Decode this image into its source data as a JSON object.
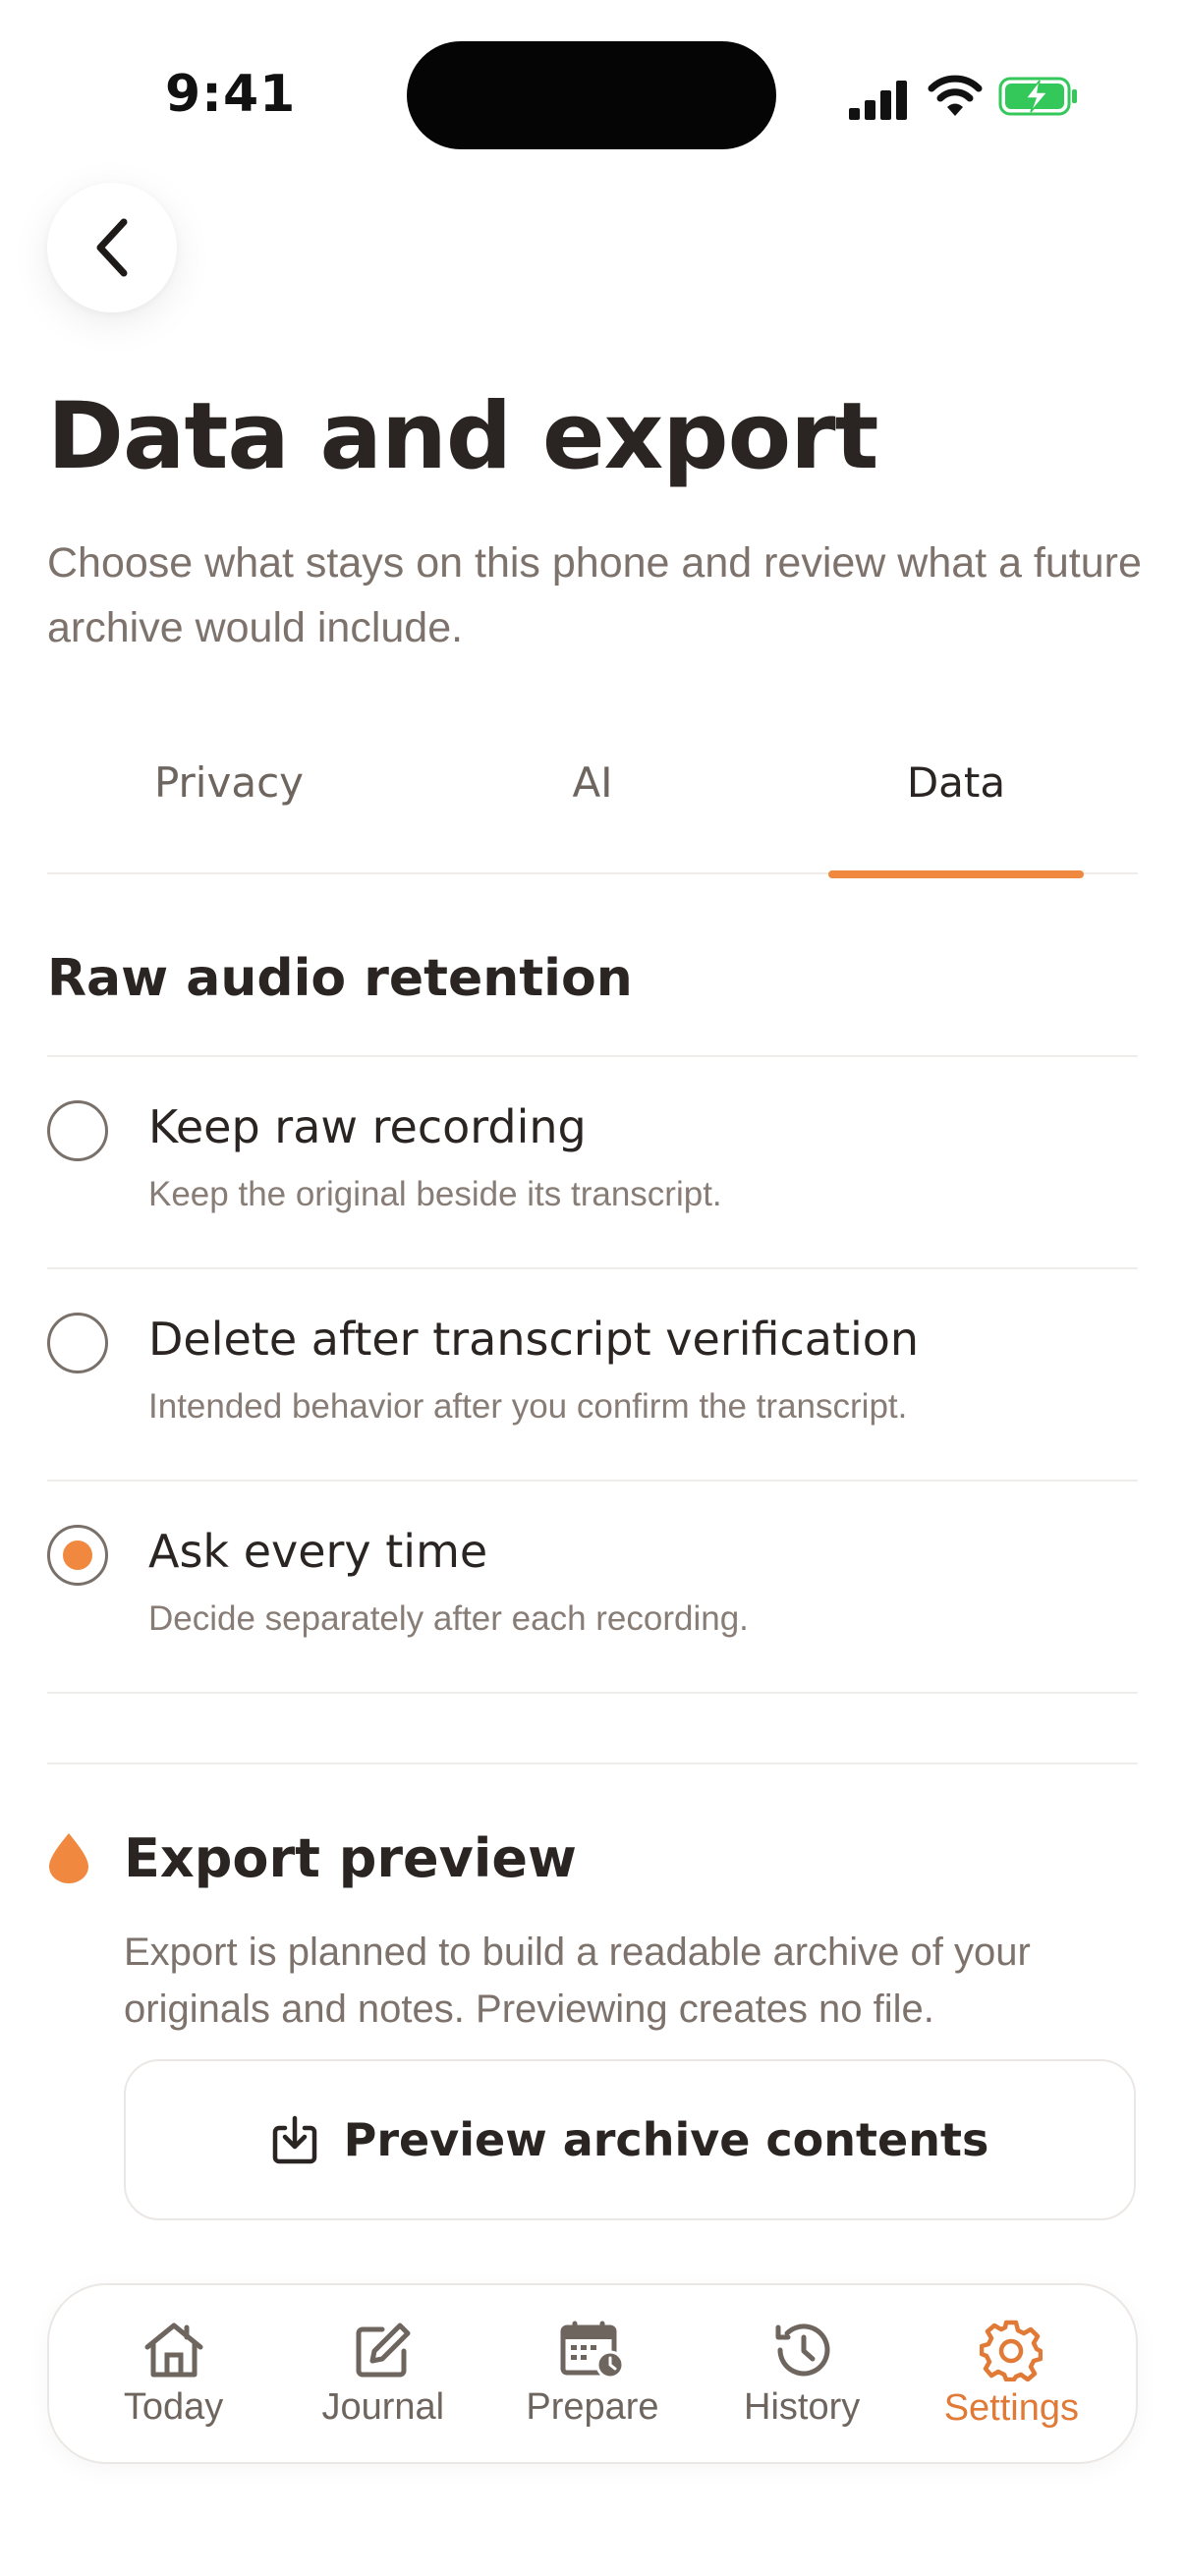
{
  "status_bar": {
    "time": "9:41"
  },
  "header": {
    "title": "Data and export",
    "subtitle": "Choose what stays on this phone and review what a future archive would include."
  },
  "tabs": [
    {
      "label": "Privacy",
      "active": false
    },
    {
      "label": "AI",
      "active": false
    },
    {
      "label": "Data",
      "active": true
    }
  ],
  "retention": {
    "title": "Raw audio retention",
    "options": [
      {
        "label": "Keep raw recording",
        "description": "Keep the original beside its transcript.",
        "selected": false
      },
      {
        "label": "Delete after transcript verification",
        "description": "Intended behavior after you confirm the transcript.",
        "selected": false
      },
      {
        "label": "Ask every time",
        "description": "Decide separately after each recording.",
        "selected": true
      }
    ]
  },
  "export": {
    "title": "Export preview",
    "description": "Export is planned to build a readable archive of your originals and notes. Previewing creates no file.",
    "button_label": "Preview archive contents"
  },
  "nav": {
    "items": [
      {
        "label": "Today",
        "icon": "home-icon",
        "active": false
      },
      {
        "label": "Journal",
        "icon": "edit-icon",
        "active": false
      },
      {
        "label": "Prepare",
        "icon": "calendar-clock-icon",
        "active": false
      },
      {
        "label": "History",
        "icon": "history-icon",
        "active": false
      },
      {
        "label": "Settings",
        "icon": "gear-icon",
        "active": true
      }
    ]
  },
  "colors": {
    "accent": "#f0883f",
    "text": "#2a2522",
    "muted": "#7d736c",
    "battery": "#34c759"
  }
}
